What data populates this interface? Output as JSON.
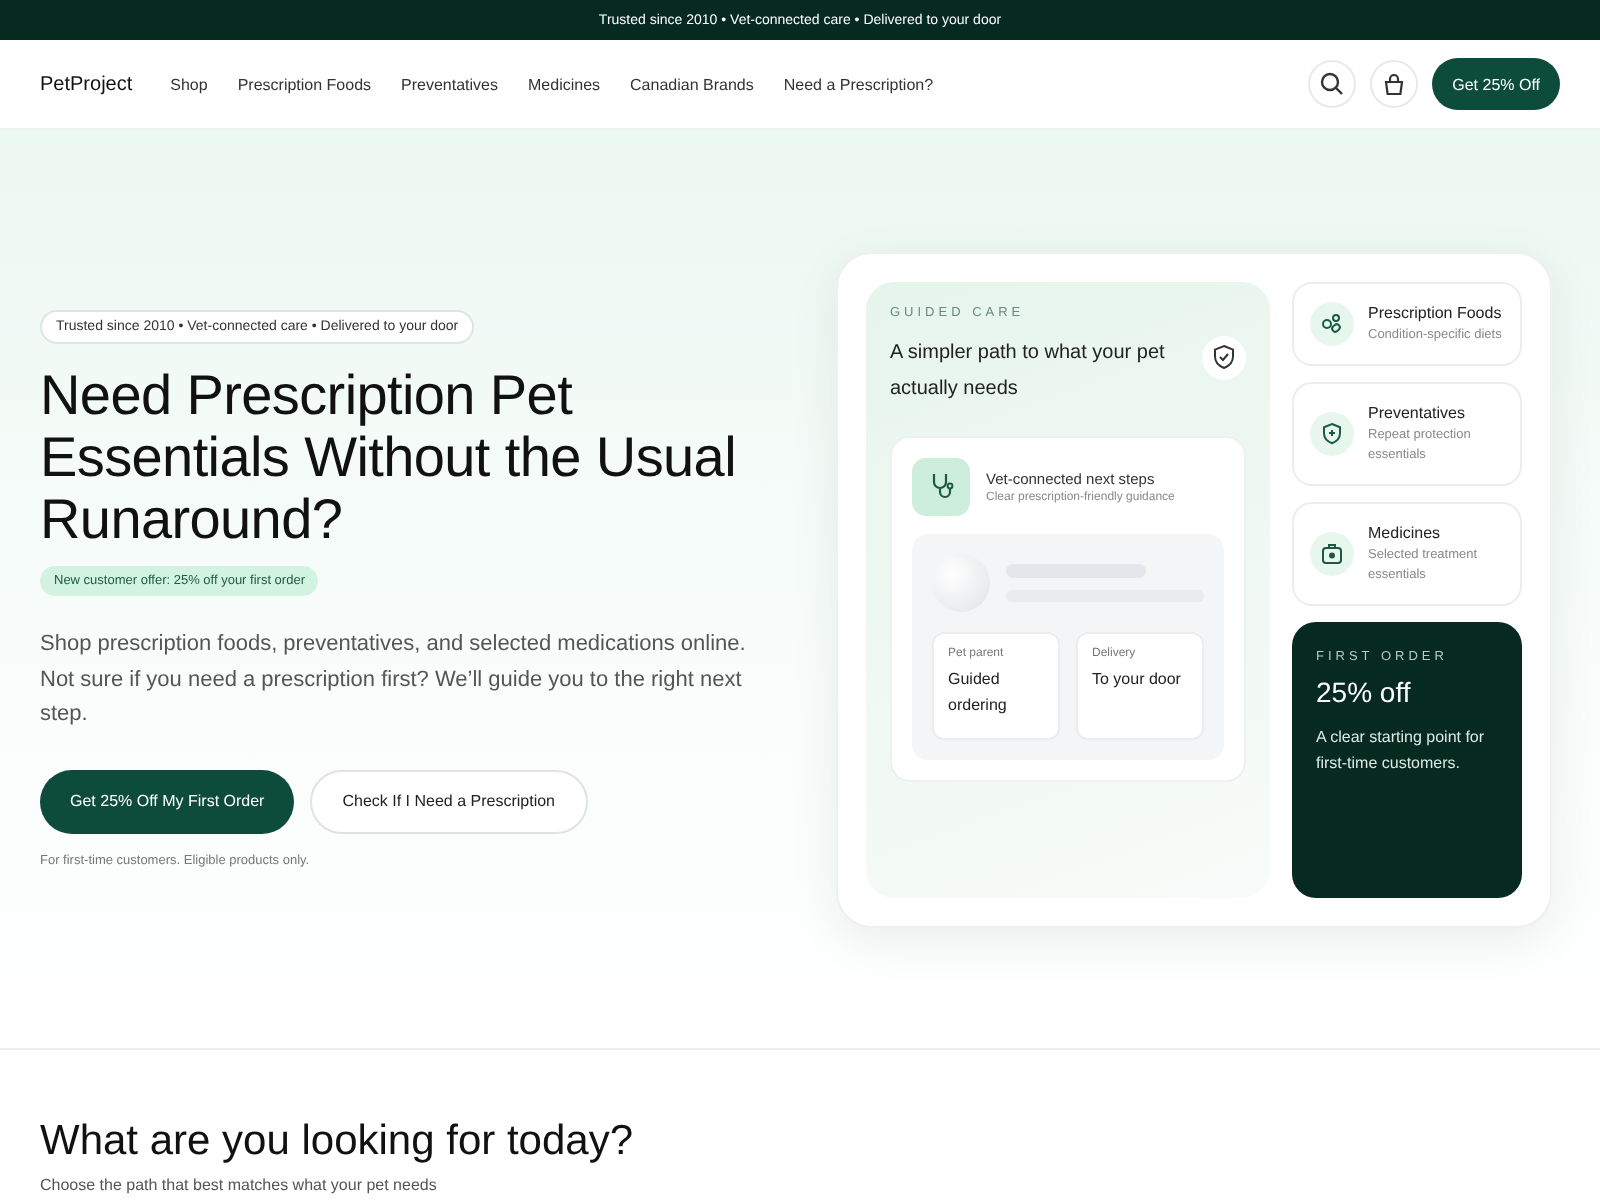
{
  "announcement": "Trusted since 2010 • Vet-connected care • Delivered to your door",
  "nav": {
    "logo": "PetProject",
    "links": [
      "Shop",
      "Prescription Foods",
      "Preventatives",
      "Medicines",
      "Canadian Brands",
      "Need a Prescription?"
    ],
    "cta": "Get 25% Off"
  },
  "hero": {
    "trust_badge": "Trusted since 2010 • Vet-connected care • Delivered to your door",
    "title": "Need Prescription Pet Essentials Without the Usual Runaround?",
    "offer_badge": "New customer offer: 25% off your first order",
    "body": "Shop prescription foods, preventatives, and selected medications online. Not sure if you need a prescription first? We’ll guide you to the right next step.",
    "buttons": [
      {
        "label": "Get 25% Off My First Order",
        "kind": "primary"
      },
      {
        "label": "Check If I Need a Prescription",
        "kind": "secondary"
      }
    ],
    "note": "For first-time customers. Eligible products only."
  },
  "guided_card": {
    "eyebrow": "GUIDED CARE",
    "title": "A simpler path to what your pet actually needs",
    "step_title": "Vet-connected next steps",
    "step_subtitle": "Clear prescription-friendly guidance",
    "tiles": [
      {
        "label": "Pet parent",
        "value": "Guided ordering"
      },
      {
        "label": "Delivery",
        "value": "To your door"
      }
    ]
  },
  "categories": [
    {
      "kind": "foods",
      "title": "Prescription Foods",
      "subtitle": "Condition-specific diets"
    },
    {
      "kind": "preventatives",
      "title": "Preventatives",
      "subtitle": "Repeat protection essentials"
    },
    {
      "kind": "medicines",
      "title": "Medicines",
      "subtitle": "Selected treatment essentials"
    }
  ],
  "first_order": {
    "eyebrow": "FIRST ORDER",
    "title": "25% off",
    "text": "A clear starting point for first-time customers."
  },
  "section": {
    "title": "What are you looking for today?",
    "subtitle": "Choose the path that best matches what your pet needs"
  }
}
